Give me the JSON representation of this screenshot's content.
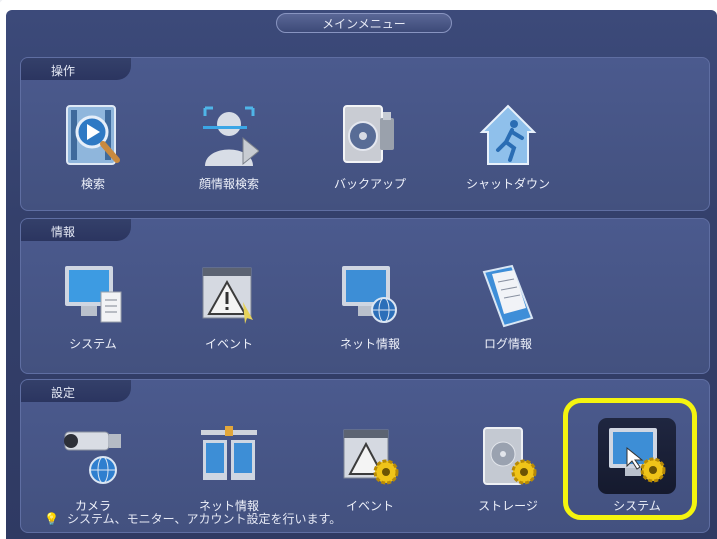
{
  "window": {
    "title": "メインメニュー"
  },
  "sections": [
    {
      "title": "操作",
      "items": [
        {
          "label": "検索",
          "icon": "search-video-icon"
        },
        {
          "label": "顔情報検索",
          "icon": "face-search-icon"
        },
        {
          "label": "バックアップ",
          "icon": "backup-icon"
        },
        {
          "label": "シャットダウン",
          "icon": "shutdown-icon"
        }
      ]
    },
    {
      "title": "情報",
      "items": [
        {
          "label": "システム",
          "icon": "system-info-icon"
        },
        {
          "label": "イベント",
          "icon": "event-warning-icon"
        },
        {
          "label": "ネット情報",
          "icon": "network-info-icon"
        },
        {
          "label": "ログ情報",
          "icon": "log-info-icon"
        }
      ]
    },
    {
      "title": "設定",
      "items": [
        {
          "label": "カメラ",
          "icon": "camera-settings-icon"
        },
        {
          "label": "ネット情報",
          "icon": "network-settings-icon"
        },
        {
          "label": "イベント",
          "icon": "event-settings-icon"
        },
        {
          "label": "ストレージ",
          "icon": "storage-settings-icon"
        },
        {
          "label": "システム",
          "icon": "system-settings-icon"
        }
      ]
    }
  ],
  "hint": "システム、モニター、アカウント設定を行います。",
  "colors": {
    "highlight": "#f4f40f",
    "panel": "#4b5a8e",
    "background": "#34406b"
  }
}
